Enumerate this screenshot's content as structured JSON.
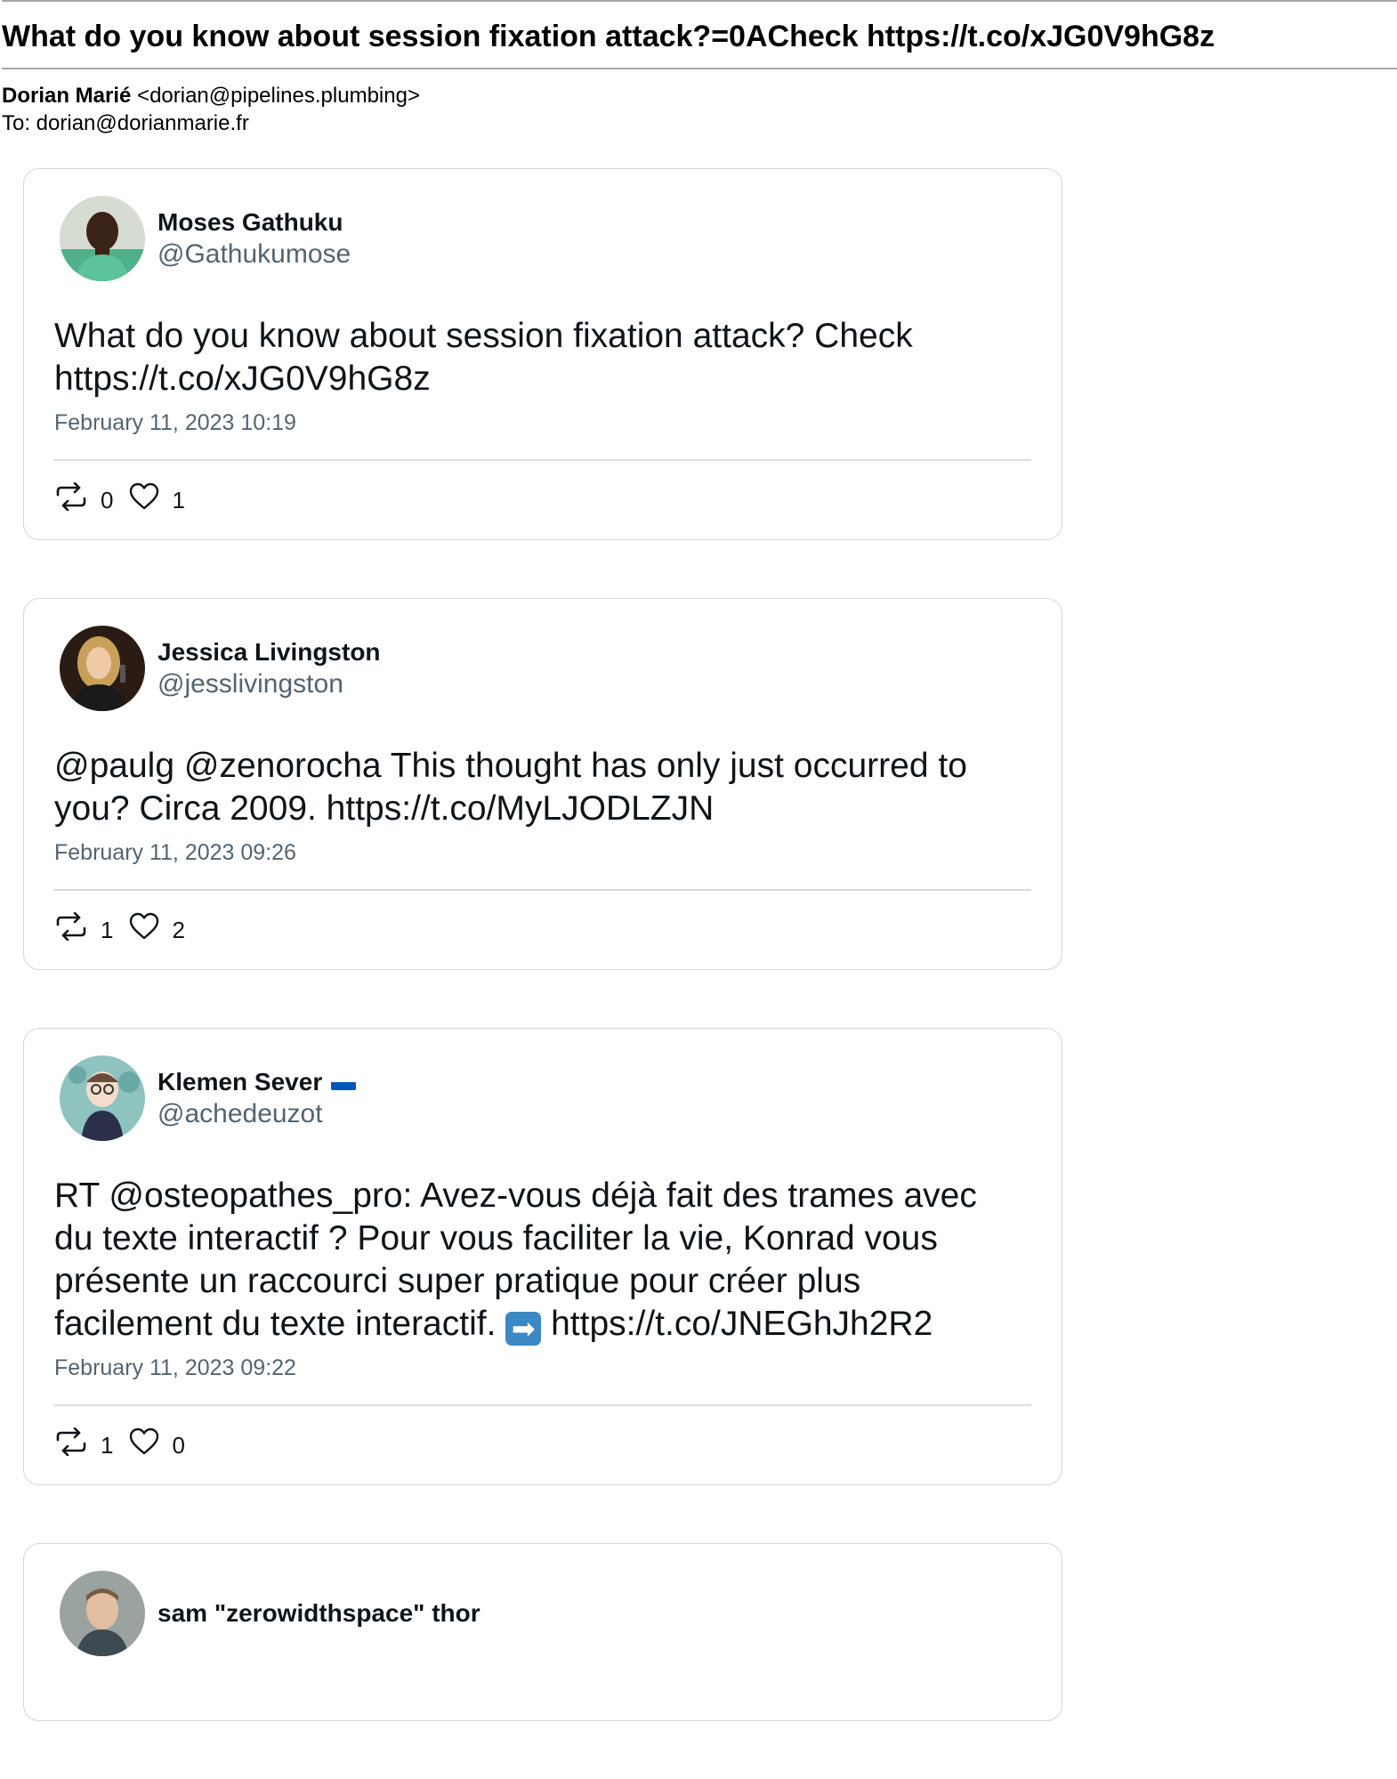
{
  "email": {
    "subject": "What do you know about session fixation attack?=0ACheck https://t.co/xJG0V9hG8z",
    "from_name": "Dorian Marié",
    "from_address": "<dorian@pipelines.plumbing>",
    "to_line": "To: dorian@dorianmarie.fr"
  },
  "tweets": [
    {
      "name": "Moses Gathuku",
      "handle": "@Gathukumose",
      "text": "What do you know about session fixation attack? Check\nhttps://t.co/xJG0V9hG8z",
      "time": "February 11, 2023 10:19",
      "retweets": "0",
      "likes": "1"
    },
    {
      "name": "Jessica Livingston",
      "handle": "@jesslivingston",
      "text": "@paulg @zenorocha This thought has only just occurred to\nyou? Circa 2009. https://t.co/MyLJODLZJN",
      "time": "February 11, 2023 09:26",
      "retweets": "1",
      "likes": "2"
    },
    {
      "name": "Klemen Sever",
      "handle": "@achedeuzot",
      "text_before": "RT @osteopathes_pro: Avez-vous déjà fait des trames avec\ndu texte interactif ? Pour vous faciliter la vie, Konrad vous\nprésente un raccourci super pratique pour créer plus\nfacilement du texte interactif. ",
      "text_after": " https://t.co/JNEGhJh2R2",
      "time": "February 11, 2023 09:22",
      "retweets": "1",
      "likes": "0"
    },
    {
      "name": "sam \"zerowidthspace\" thor"
    }
  ],
  "icons": {
    "retweet": "retweet-icon",
    "like": "heart-icon",
    "flag": "ukraine-flag-icon"
  },
  "colors": {
    "text": "#0f1419",
    "muted": "#536471",
    "card_border": "#d3d7db",
    "flag_blue": "#0057b7",
    "flag_yellow": "#ffd700"
  }
}
